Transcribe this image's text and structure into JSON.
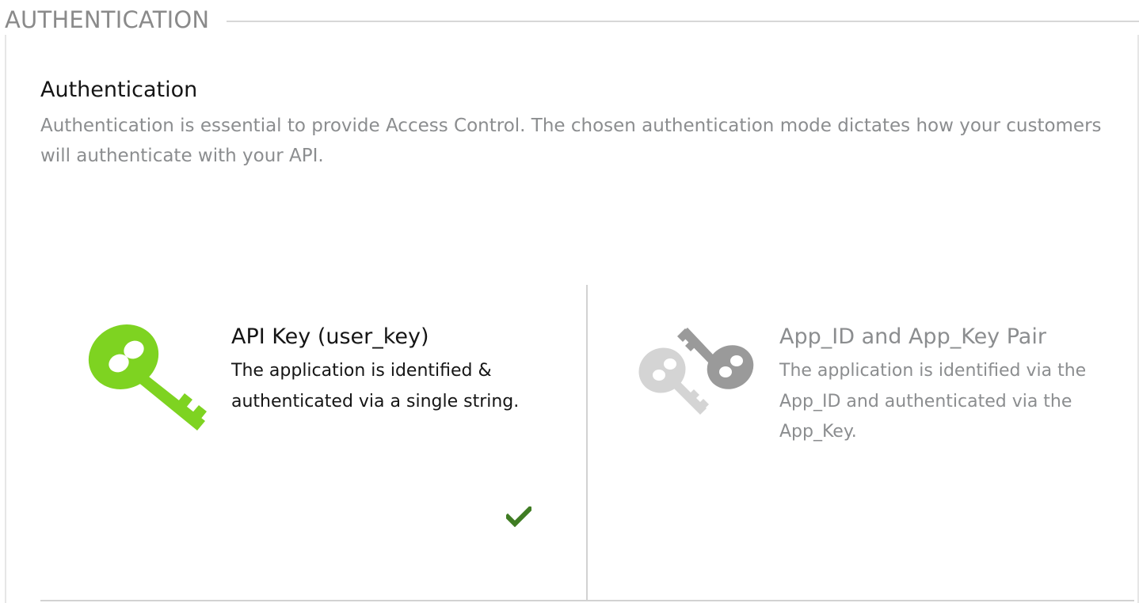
{
  "fieldset": {
    "legend": "AUTHENTICATION"
  },
  "section": {
    "title": "Authentication",
    "description": "Authentication is essential to provide Access Control. The chosen authentication mode dictates how your customers will authenticate with your API."
  },
  "options": [
    {
      "title": "API Key (user_key)",
      "description": "The application is identified & authenticated via a single string.",
      "icon": "single-key-icon",
      "selected": true,
      "color": "#7ed321"
    },
    {
      "title": "App_ID and App_Key Pair",
      "description": "The application is identified via the App_ID and authenticated via the App_Key.",
      "icon": "key-pair-icon",
      "selected": false,
      "color": "#8b8d8f"
    }
  ],
  "selected_indicator": {
    "icon": "checkmark-icon",
    "color": "#3f7c23"
  }
}
